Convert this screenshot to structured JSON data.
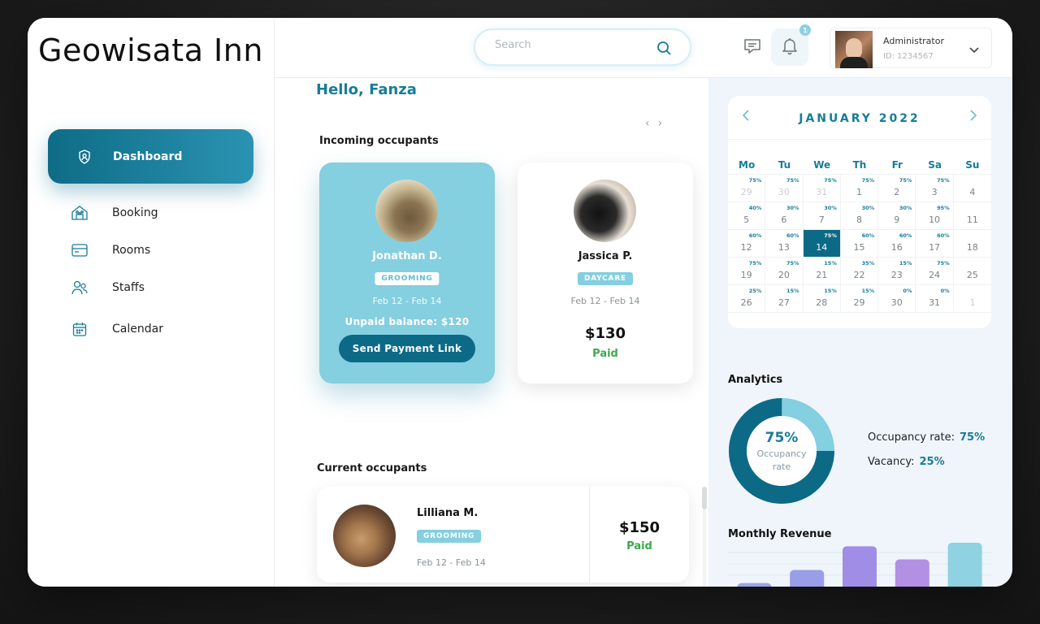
{
  "app": {
    "brand": "Geowisata Inn"
  },
  "sidebar": {
    "items": [
      {
        "label": "Dashboard",
        "icon": "dashboard-icon",
        "active": true
      },
      {
        "label": "Booking",
        "icon": "booking-icon"
      },
      {
        "label": "Rooms",
        "icon": "rooms-icon"
      },
      {
        "label": "Staffs",
        "icon": "staffs-icon"
      },
      {
        "label": "Calendar",
        "icon": "calendar-icon"
      }
    ]
  },
  "topbar": {
    "search_placeholder": "Search",
    "notification_count": "1",
    "user": {
      "role": "Administrator",
      "id": "ID: 1234567"
    }
  },
  "main": {
    "greeting": "Hello, Fanza",
    "incoming_title": "Incoming occupants",
    "incoming": [
      {
        "name": "Jonathan D.",
        "service": "GROOMING",
        "dates": "Feb 12 - Feb 14",
        "balance": "Unpaid balance: $120",
        "action": "Send Payment Link"
      },
      {
        "name": "Jassica P.",
        "service": "DAYCARE",
        "dates": "Feb 12 - Feb 14",
        "amount": "$130",
        "status": "Paid"
      }
    ],
    "current_title": "Current occupants",
    "current": [
      {
        "name": "Lilliana M.",
        "service": "GROOMING",
        "dates": "Feb 12 - Feb 14",
        "amount": "$150",
        "status": "Paid"
      }
    ]
  },
  "calendar": {
    "month": "JANUARY 2022",
    "dows": [
      "Mo",
      "Tu",
      "We",
      "Th",
      "Fr",
      "Sa",
      "Su"
    ],
    "selected_day": "14",
    "cells": [
      {
        "d": "29",
        "p": "75%",
        "m": true
      },
      {
        "d": "30",
        "p": "75%",
        "m": true
      },
      {
        "d": "31",
        "p": "75%",
        "m": true
      },
      {
        "d": "1",
        "p": "75%"
      },
      {
        "d": "2",
        "p": "75%"
      },
      {
        "d": "3",
        "p": "75%"
      },
      {
        "d": "4",
        "p": ""
      },
      {
        "d": "5",
        "p": "40%"
      },
      {
        "d": "6",
        "p": "30%"
      },
      {
        "d": "7",
        "p": "30%"
      },
      {
        "d": "8",
        "p": "30%"
      },
      {
        "d": "9",
        "p": "30%"
      },
      {
        "d": "10",
        "p": "95%"
      },
      {
        "d": "11",
        "p": ""
      },
      {
        "d": "12",
        "p": "60%"
      },
      {
        "d": "13",
        "p": "60%"
      },
      {
        "d": "14",
        "p": "75%"
      },
      {
        "d": "15",
        "p": "60%"
      },
      {
        "d": "16",
        "p": "60%"
      },
      {
        "d": "17",
        "p": "60%"
      },
      {
        "d": "18",
        "p": ""
      },
      {
        "d": "19",
        "p": "75%"
      },
      {
        "d": "20",
        "p": "75%"
      },
      {
        "d": "21",
        "p": "15%"
      },
      {
        "d": "22",
        "p": "35%"
      },
      {
        "d": "23",
        "p": "15%"
      },
      {
        "d": "24",
        "p": "75%"
      },
      {
        "d": "25",
        "p": ""
      },
      {
        "d": "26",
        "p": "25%"
      },
      {
        "d": "27",
        "p": "15%"
      },
      {
        "d": "28",
        "p": "15%"
      },
      {
        "d": "29",
        "p": "15%"
      },
      {
        "d": "30",
        "p": "0%"
      },
      {
        "d": "31",
        "p": "0%"
      },
      {
        "d": "1",
        "p": "",
        "m": true
      }
    ]
  },
  "analytics": {
    "title": "Analytics",
    "occupancy_value": "75%",
    "occupancy_fraction": 0.75,
    "donut_label": "Occupancy rate",
    "occupancy_label": "Occupancy rate:",
    "vacancy_label": "Vacancy:",
    "vacancy_value": "25%",
    "colors": {
      "primary": "#0c6a86",
      "secondary": "#84cfe0"
    }
  },
  "revenue": {
    "title": "Monthly Revenue",
    "bar_levels": [
      0.08,
      0.38,
      0.92,
      0.62,
      1.0
    ],
    "bar_colors": [
      "#9aa4e6",
      "#9a9de8",
      "#a08ee6",
      "#b290e4",
      "#8fd2e2"
    ]
  }
}
